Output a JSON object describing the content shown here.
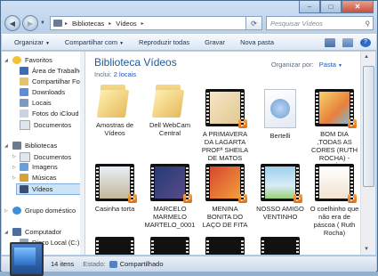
{
  "address": {
    "crumbs": [
      "Bibliotecas",
      "Vídeos"
    ]
  },
  "search": {
    "placeholder": "Pesquisar Vídeos"
  },
  "toolbar": {
    "organize": "Organizar",
    "share": "Compartilhar com",
    "play_all": "Reproduzir todas",
    "burn": "Gravar",
    "new_folder": "Nova pasta"
  },
  "nav": {
    "favorites": "Favoritos",
    "desktop": "Área de Trabalho",
    "shared": "Compartilhar Fot",
    "downloads": "Downloads",
    "locals": "Locais",
    "icloud": "Fotos do iCloud",
    "documents_fav": "Documentos",
    "libraries": "Bibliotecas",
    "documents": "Documentos",
    "images": "Imagens",
    "music": "Músicas",
    "videos": "Vídeos",
    "homegroup": "Grupo doméstico",
    "computer": "Computador",
    "local_disk": "Disco Local (C:)"
  },
  "main": {
    "title": "Biblioteca Vídeos",
    "includes_label": "Inclui:",
    "includes_link": "2 locais",
    "arrange_label": "Organizar por:",
    "arrange_value": "Pasta"
  },
  "items": [
    {
      "name": "Amostras de Vídeos",
      "kind": "folder"
    },
    {
      "name": "Dell WebCam Central",
      "kind": "folder"
    },
    {
      "name": "A PRIMAVERA DA LAGARTA PROFª SHEILA DE MATOS",
      "kind": "video"
    },
    {
      "name": "Bertelli",
      "kind": "file"
    },
    {
      "name": "BOM DIA ,TODAS AS CORES (RUTH ROCHA) - HISTÓRIA NAR...",
      "kind": "video"
    },
    {
      "name": "Casinha torta",
      "kind": "video"
    },
    {
      "name": "MARCELO MARMELO MARTELO_0001",
      "kind": "video"
    },
    {
      "name": "MENINA BONITA DO LAÇO DE FITA",
      "kind": "video"
    },
    {
      "name": "NOSSO AMIGO VENTINHO",
      "kind": "video"
    },
    {
      "name": "O coelhinho que não era de páscoa ( Ruth Rocha)",
      "kind": "video"
    }
  ],
  "status": {
    "count": "14 itens",
    "state_label": "Estado:",
    "state_value": "Compartilhado"
  },
  "colors": {
    "accent": "#1e5a98",
    "link": "#1a56b8",
    "selection": "#cce4f7"
  }
}
